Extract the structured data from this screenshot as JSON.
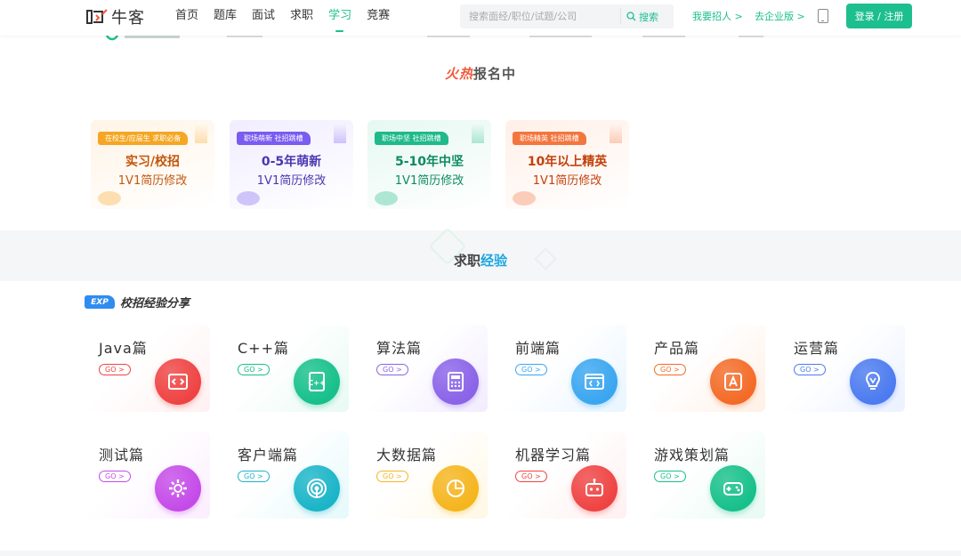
{
  "header": {
    "logo_text": "牛客",
    "nav": [
      "首页",
      "题库",
      "面试",
      "求职",
      "学习",
      "竞赛"
    ],
    "active_nav": 4,
    "search_placeholder": "搜索面经/职位/试题/公司",
    "search_label": "搜索",
    "hire_link": "我要招人 >",
    "enterprise_link": "去企业版 >",
    "login_label": "登录 / 注册"
  },
  "hot_section": {
    "title_hot": "火热",
    "title_rest": "报名中",
    "cards": [
      {
        "tag": "在校生/应届生 求职必备",
        "line1": "实习/校招",
        "line2": "1V1简历修改",
        "accent": "#f5a623",
        "text_color": "#c2570c",
        "bg": "#fff4e6"
      },
      {
        "tag": "职场萌新 社招跳槽",
        "line1": "0-5年萌新",
        "line2": "1V1简历修改",
        "accent": "#7a5cf0",
        "text_color": "#4a36b0",
        "bg": "#f1edff"
      },
      {
        "tag": "职场中坚 社招跳槽",
        "line1": "5-10年中坚",
        "line2": "1V1简历修改",
        "accent": "#1fb98a",
        "text_color": "#0e8a63",
        "bg": "#e6f8f1"
      },
      {
        "tag": "职场精英 社招跳槽",
        "line1": "10年以上精英",
        "line2": "1V1简历修改",
        "accent": "#f3763e",
        "text_color": "#c2410c",
        "bg": "#fff0e8"
      }
    ]
  },
  "exp_section": {
    "title_a": "求职",
    "title_b": "经验",
    "badge": "EXP",
    "subtitle": "校招经验分享",
    "go_label": "GO >",
    "cards": [
      {
        "title": "Java篇",
        "color": "#ef4343",
        "bg": "#fff0f0",
        "icon": "code-folder-icon"
      },
      {
        "title": "C++篇",
        "color": "#17c08a",
        "bg": "#e8faf3",
        "icon": "cpp-file-icon"
      },
      {
        "title": "算法篇",
        "color": "#8a63e8",
        "bg": "#f2ecff",
        "icon": "calculator-icon"
      },
      {
        "title": "前端篇",
        "color": "#3aa6f0",
        "bg": "#e9f5ff",
        "icon": "browser-code-icon"
      },
      {
        "title": "产品篇",
        "color": "#f36b27",
        "bg": "#fff0e6",
        "icon": "app-store-icon"
      },
      {
        "title": "运营篇",
        "color": "#4b7bef",
        "bg": "#ebf1ff",
        "icon": "lightbulb-icon"
      },
      {
        "title": "测试篇",
        "color": "#c54be8",
        "bg": "#fbeeff",
        "icon": "gear-icon"
      },
      {
        "title": "客户端篇",
        "color": "#1ab5c8",
        "bg": "#e6f9fb",
        "icon": "signal-icon"
      },
      {
        "title": "大数据篇",
        "color": "#f5b51e",
        "bg": "#fff8e4",
        "icon": "pie-chart-icon"
      },
      {
        "title": "机器学习篇",
        "color": "#ef4343",
        "bg": "#fff0f0",
        "icon": "robot-icon"
      },
      {
        "title": "游戏策划篇",
        "color": "#17c08a",
        "bg": "#e8faf3",
        "icon": "gamepad-icon"
      }
    ]
  }
}
